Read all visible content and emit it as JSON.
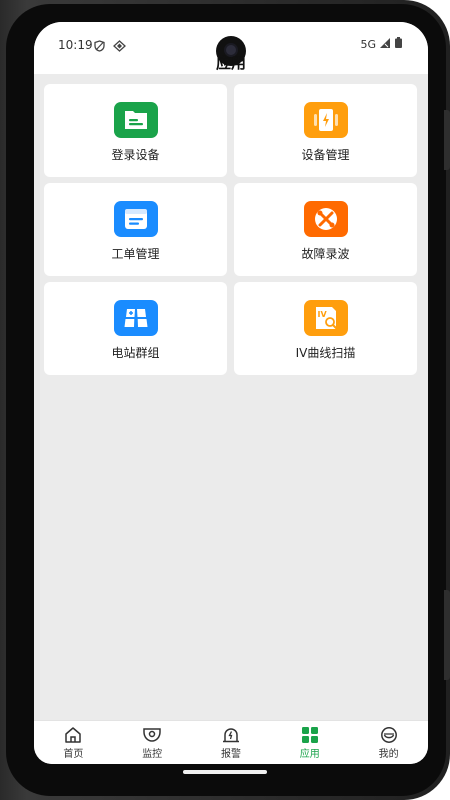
{
  "status": {
    "time": "10:19",
    "network": "5G",
    "icons": [
      "shield-icon",
      "location-icon",
      "signal-icon",
      "battery-icon"
    ]
  },
  "header": {
    "title": "应用"
  },
  "apps": [
    {
      "label": "登录设备",
      "icon": "login-device-icon",
      "color": "#1aa34a"
    },
    {
      "label": "设备管理",
      "icon": "device-management-icon",
      "color": "#ff9e0d"
    },
    {
      "label": "工单管理",
      "icon": "work-order-icon",
      "color": "#1a8cff"
    },
    {
      "label": "故障录波",
      "icon": "fault-recording-icon",
      "color": "#ff6a00"
    },
    {
      "label": "电站群组",
      "icon": "station-group-icon",
      "color": "#1a8cff"
    },
    {
      "label": "IV曲线扫描",
      "icon": "iv-curve-scan-icon",
      "color": "#ff9e0d"
    }
  ],
  "nav": {
    "items": [
      {
        "label": "首页",
        "icon": "home-icon"
      },
      {
        "label": "监控",
        "icon": "monitor-icon"
      },
      {
        "label": "报警",
        "icon": "alarm-icon"
      },
      {
        "label": "应用",
        "icon": "apps-grid-icon",
        "active": true
      },
      {
        "label": "我的",
        "icon": "profile-icon"
      }
    ],
    "active_color": "#1aa34a"
  }
}
